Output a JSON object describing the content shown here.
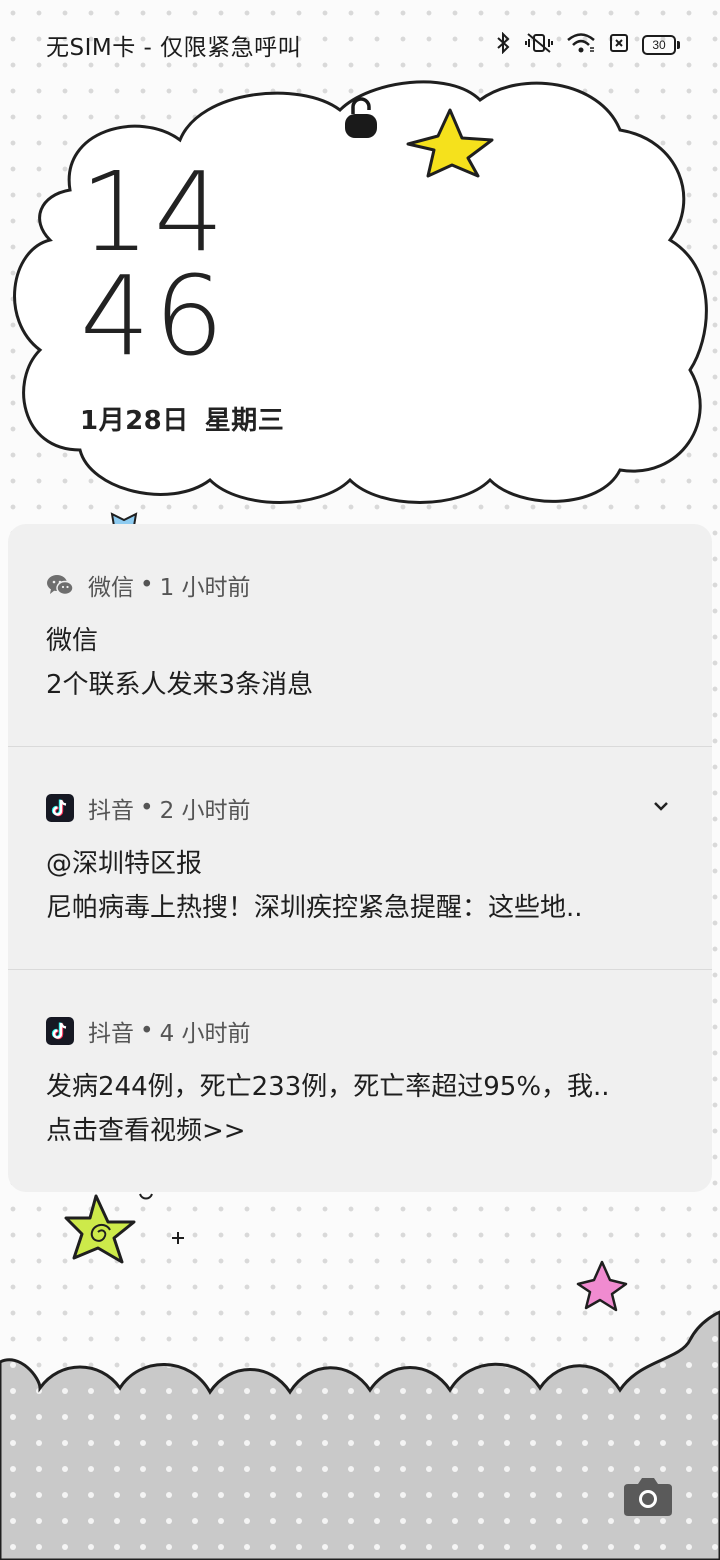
{
  "status_bar": {
    "carrier_text": "无SIM卡 - 仅限紧急呼叫",
    "icons": [
      "bluetooth-icon",
      "vibrate-mute-icon",
      "wifi-icon",
      "sim-absent-icon"
    ],
    "battery_level": "30"
  },
  "lockscreen": {
    "lock_icon": "unlock-icon",
    "clock": {
      "hour": "14",
      "minute": "46"
    },
    "date": {
      "day": "1月28日",
      "weekday": "星期三"
    }
  },
  "notifications": [
    {
      "app": "微信",
      "icon": "wechat-icon",
      "time": "1 小时前",
      "title": "微信",
      "body": "2个联系人发来3条消息"
    },
    {
      "app": "抖音",
      "icon": "douyin-icon",
      "time": "2 小时前",
      "title": "@深圳特区报",
      "body": "尼帕病毒上热搜！深圳疾控紧急提醒：这些地..",
      "expandable": true
    },
    {
      "app": "抖音",
      "icon": "douyin-icon",
      "time": "4 小时前",
      "title": "发病244例，死亡233例，死亡率超过95%，我..",
      "body": "点击查看视频>>"
    }
  ],
  "separator": "•",
  "camera_shortcut": "camera-icon",
  "colors": {
    "panel_bg": "#f0f0f0",
    "text_primary": "#1e1e1e",
    "text_secondary": "#555555",
    "star_yellow": "#f5e11c",
    "star_green": "#cdea4a",
    "star_pink": "#f08bd0"
  }
}
